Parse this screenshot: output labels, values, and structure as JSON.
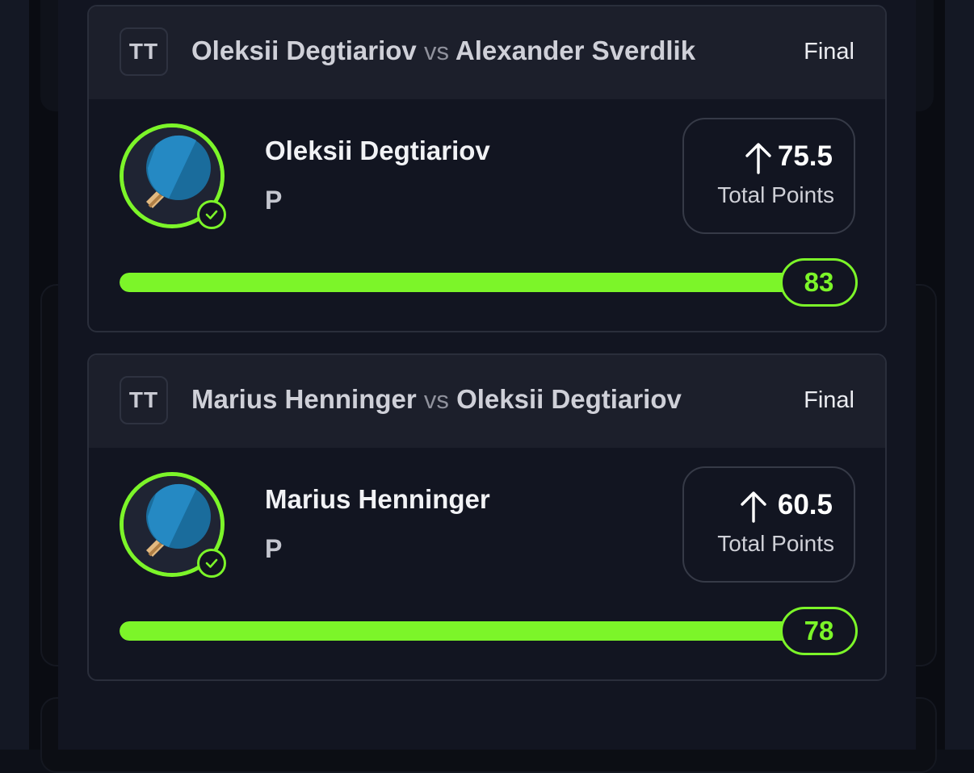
{
  "colors": {
    "accent": "#7cf529",
    "sheet_bg": "#121521",
    "header_bg": "#1c1f2b"
  },
  "cards": [
    {
      "sport_badge": "TT",
      "player1": "Oleksii Degtiariov",
      "vs": "vs",
      "player2": "Alexander Sverdlik",
      "status": "Final",
      "avatar_icon": "ping-pong-paddle-icon",
      "player_name": "Oleksii Degtiariov",
      "position": "P",
      "line_direction_icon": "arrow-up-icon",
      "line_value": "75.5",
      "line_label": "Total Points",
      "score": "83",
      "progress_percent": 100
    },
    {
      "sport_badge": "TT",
      "player1": "Marius Henninger",
      "vs": "vs",
      "player2": "Oleksii Degtiariov",
      "status": "Final",
      "avatar_icon": "ping-pong-paddle-icon",
      "player_name": "Marius Henninger",
      "position": "P",
      "line_direction_icon": "arrow-up-icon",
      "line_value": "60.5",
      "line_label": "Total Points",
      "score": "78",
      "progress_percent": 100
    }
  ]
}
